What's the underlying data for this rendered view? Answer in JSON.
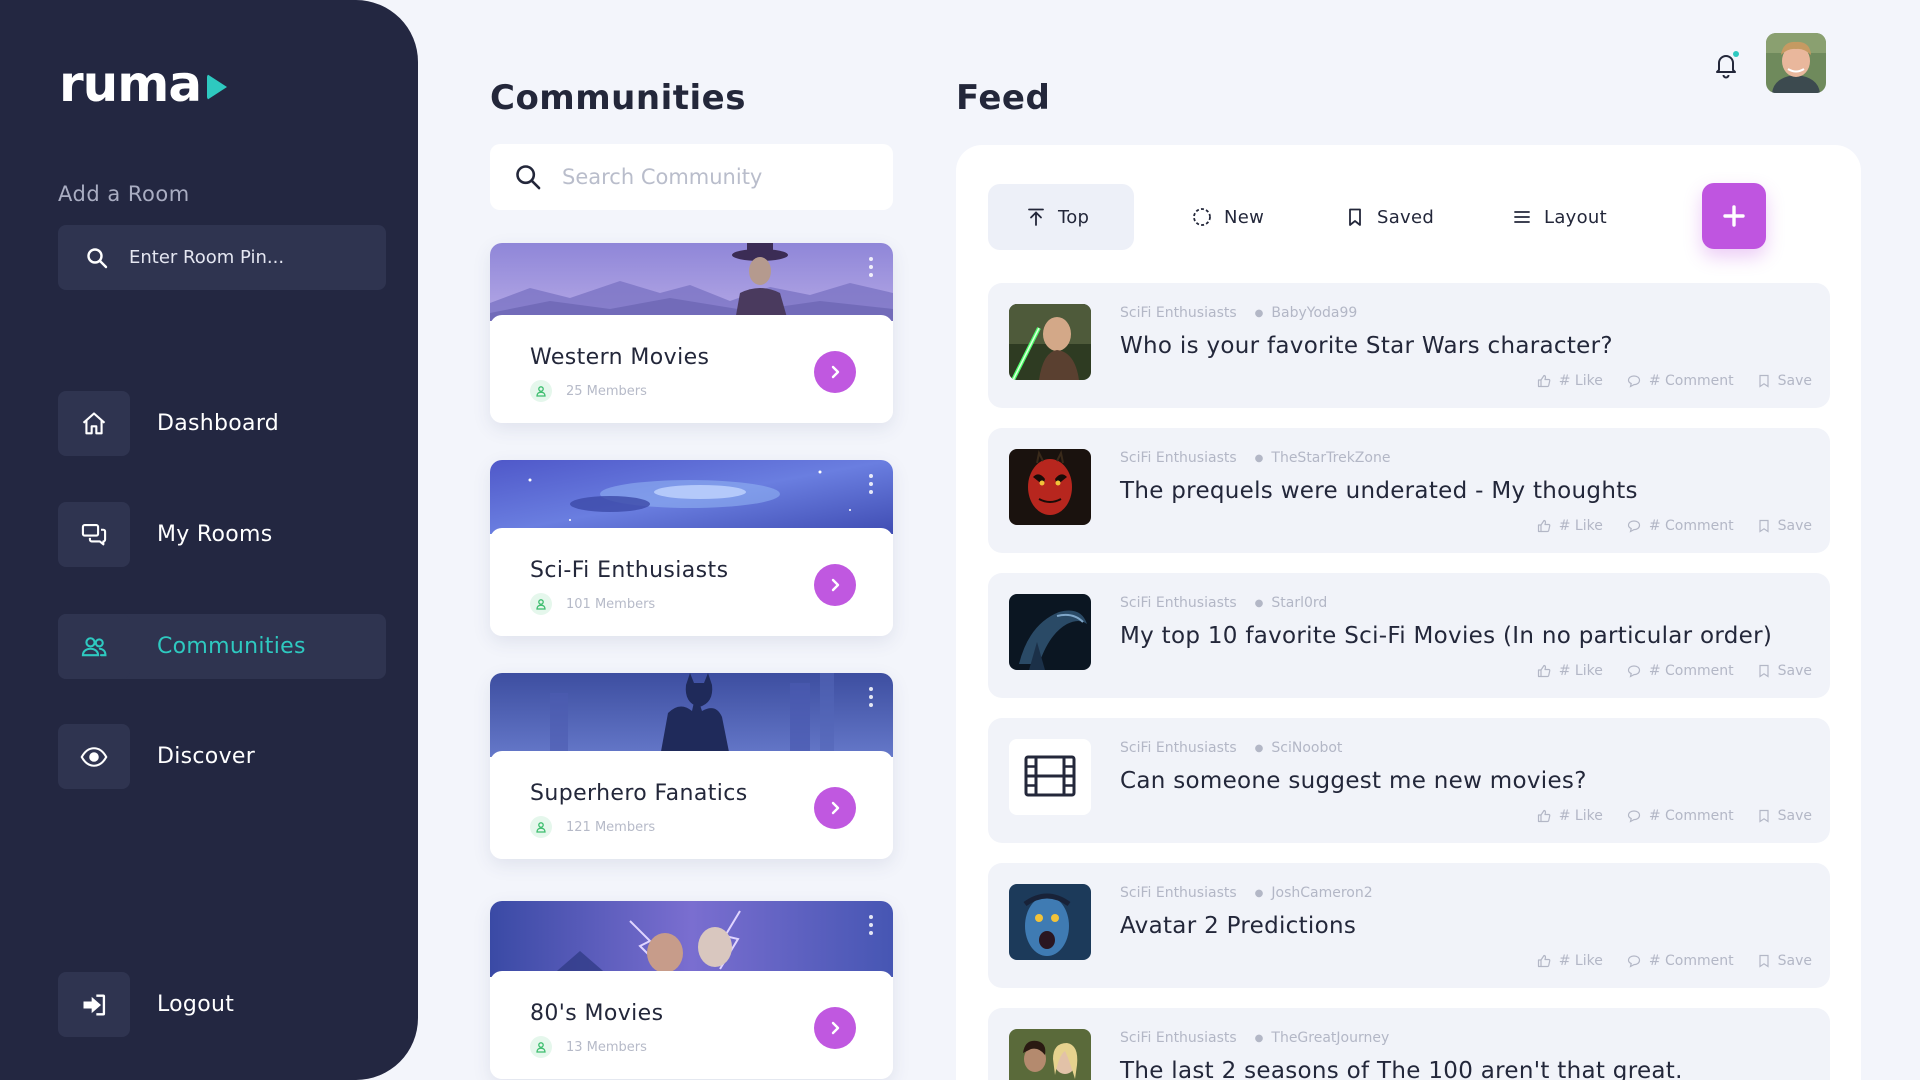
{
  "sidebar": {
    "logo": "ruma",
    "add_room_label": "Add a Room",
    "room_pin_placeholder": "Enter Room Pin...",
    "nav": [
      {
        "label": "Dashboard",
        "icon": "home-icon"
      },
      {
        "label": "My Rooms",
        "icon": "chat-icon"
      },
      {
        "label": "Communities",
        "icon": "users-icon",
        "active": true
      },
      {
        "label": "Discover",
        "icon": "eye-icon"
      }
    ],
    "logout_label": "Logout"
  },
  "communities": {
    "title": "Communities",
    "search_placeholder": "Search Community",
    "items": [
      {
        "name": "Western Movies",
        "members": "25 Members"
      },
      {
        "name": "Sci-Fi Enthusiasts",
        "members": "101 Members"
      },
      {
        "name": "Superhero Fanatics",
        "members": "121 Members"
      },
      {
        "name": "80's Movies",
        "members": "13 Members"
      }
    ]
  },
  "feed": {
    "title": "Feed",
    "tabs": [
      {
        "label": "Top",
        "icon": "arrow-up-icon",
        "active": true
      },
      {
        "label": "New",
        "icon": "loading-circle-icon"
      },
      {
        "label": "Saved",
        "icon": "bookmark-icon"
      },
      {
        "label": "Layout",
        "icon": "menu-icon"
      }
    ],
    "actions": {
      "like": "# Like",
      "comment": "# Comment",
      "save": "Save"
    },
    "posts": [
      {
        "community": "SciFi Enthusiasts",
        "author": "BabyYoda99",
        "title": "Who is your favorite Star Wars character?"
      },
      {
        "community": "SciFi Enthusiasts",
        "author": "TheStarTrekZone",
        "title": "The prequels were underated - My thoughts"
      },
      {
        "community": "SciFi Enthusiasts",
        "author": "Starl0rd",
        "title": "My top 10 favorite Sci-Fi Movies (In no particular order)"
      },
      {
        "community": "SciFi Enthusiasts",
        "author": "SciNoobot",
        "title": "Can someone suggest me new movies?"
      },
      {
        "community": "SciFi Enthusiasts",
        "author": "JoshCameron2",
        "title": "Avatar 2 Predictions"
      },
      {
        "community": "SciFi Enthusiasts",
        "author": "TheGreatJourney",
        "title": "The last 2 seasons of The 100 aren't that great."
      }
    ]
  },
  "colors": {
    "sidebar_bg": "#232741",
    "accent_teal": "#2ec9c0",
    "accent_purple": "#c058e0",
    "page_bg": "#f3f5fb"
  }
}
